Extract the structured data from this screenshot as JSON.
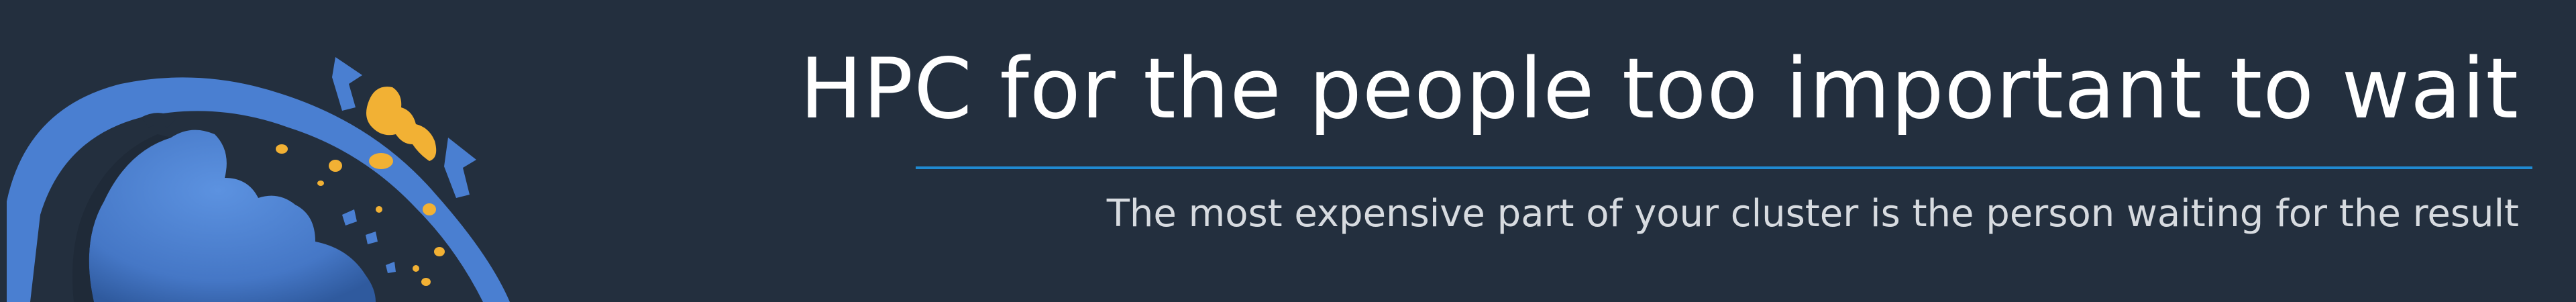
{
  "banner": {
    "headline": "HPC for the people too important to wait",
    "subline": "The most expensive part of your cluster is the person waiting for the result",
    "logo_icon": "cloud-fragmenting-circle-logo",
    "colors": {
      "background": "#232f3e",
      "headline": "#ffffff",
      "subline": "#d7dbe0",
      "divider": "#1f8ad1",
      "logo_blue": "#4a7fd1",
      "logo_blue_dark": "#3a63b0",
      "logo_accent": "#f2b134"
    }
  }
}
